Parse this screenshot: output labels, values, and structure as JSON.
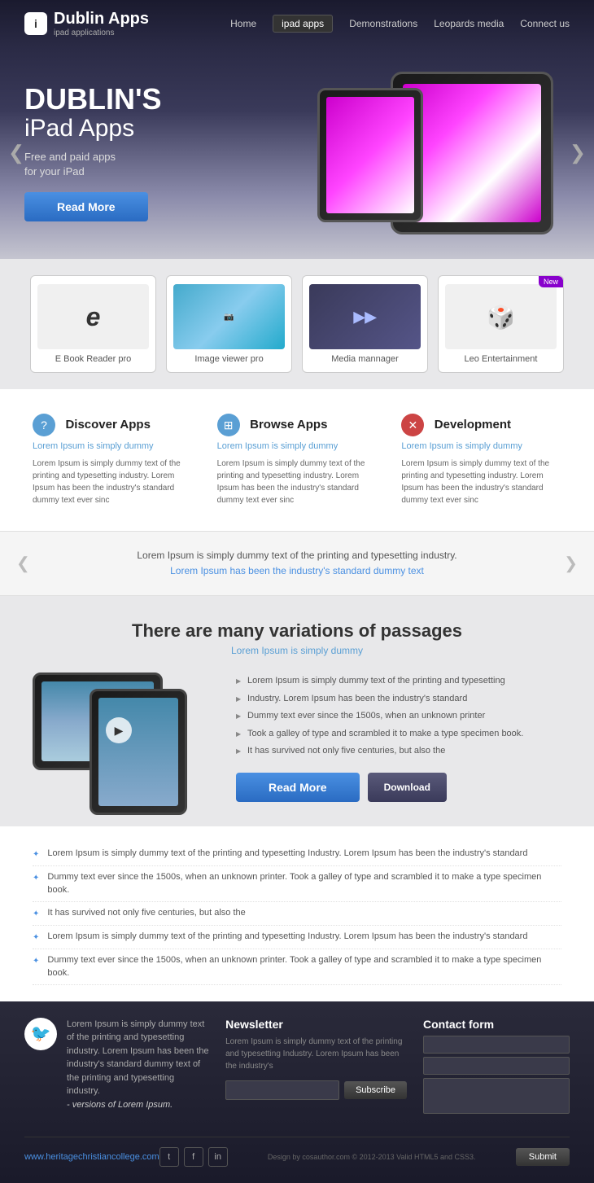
{
  "header": {
    "logo_icon": "i",
    "logo_title": "Dublin Apps",
    "logo_subtitle": "ipad applications",
    "nav": [
      {
        "label": "Home",
        "active": false
      },
      {
        "label": "ipad apps",
        "active": true
      },
      {
        "label": "Demonstrations",
        "active": false
      },
      {
        "label": "Leopards media",
        "active": false
      },
      {
        "label": "Connect us",
        "active": false
      }
    ]
  },
  "hero": {
    "title_main": "DUBLIN'S",
    "title_sub": "iPad Apps",
    "description": "Free and paid apps\nfor your iPad",
    "cta_label": "Read More"
  },
  "apps": [
    {
      "label": "E Book Reader pro",
      "icon_type": "ebook",
      "new": false
    },
    {
      "label": "Image viewer pro",
      "icon_type": "photo",
      "new": false
    },
    {
      "label": "Media mannager",
      "icon_type": "media",
      "new": false
    },
    {
      "label": "Leo Entertainment",
      "icon_type": "dice",
      "new": true
    }
  ],
  "features": [
    {
      "icon": "?",
      "title": "Discover Apps",
      "subtitle": "Lorem Ipsum is simply dummy",
      "text": "Lorem Ipsum is simply dummy text of the printing and typesetting industry. Lorem Ipsum has been the industry's standard dummy text ever sinc"
    },
    {
      "icon": "⊞",
      "title": "Browse Apps",
      "subtitle": "Lorem Ipsum is simply dummy",
      "text": "Lorem Ipsum is simply dummy text of the printing and typesetting industry. Lorem Ipsum has been the industry's standard dummy text ever sinc"
    },
    {
      "icon": "✕",
      "title": "Development",
      "subtitle": "Lorem Ipsum is simply dummy",
      "text": "Lorem Ipsum is simply dummy text of the printing and typesetting industry. Lorem Ipsum has been the industry's standard dummy text ever sinc"
    }
  ],
  "testimonial": {
    "text": "Lorem Ipsum is simply dummy text of the printing and typesetting industry.",
    "highlight_text": "Lorem Ipsum has been the industry's standard dummy text"
  },
  "mid": {
    "title": "There are many variations of passages",
    "subtitle": "Lorem Ipsum is simply dummy",
    "list_items": [
      "Lorem Ipsum is simply dummy text of the printing and typesetting",
      "Industry. Lorem Ipsum has been the industry's standard",
      "Dummy text ever since the 1500s, when an unknown printer",
      "Took a galley of type and scrambled it to make a type specimen book.",
      "It has survived not only five centuries, but also the"
    ],
    "read_more_label": "Read More",
    "download_label": "Download"
  },
  "bullets": [
    "Lorem Ipsum is simply dummy text of the printing and typesetting Industry. Lorem Ipsum has been the industry's standard",
    "Dummy text ever since the 1500s, when an unknown printer. Took a galley of type and scrambled it to make a type specimen book.",
    "It has survived not only five centuries, but also the",
    "Lorem Ipsum is simply dummy text of the printing and typesetting Industry. Lorem Ipsum has been the industry's standard",
    "Dummy text ever since the 1500s, when an unknown printer. Took a galley of type and scrambled it to make a type specimen book."
  ],
  "footer": {
    "twitter_text": "Lorem Ipsum is simply dummy text of the printing and typesetting industry. Lorem Ipsum has been the industry's standard dummy text  of the printing and typesetting industry.",
    "twitter_italic": "- versions of Lorem Ipsum.",
    "newsletter_title": "Newsletter",
    "newsletter_text": "Lorem Ipsum is simply dummy text of the printing and typesetting Industry. Lorem Ipsum has been the industry's",
    "subscribe_label": "Subscribe",
    "contact_title": "Contact form",
    "url": "www.heritagechristiancollege.com",
    "social_icons": [
      "t",
      "f",
      "in"
    ],
    "copyright": "Design by cosauthor.com © 2012-2013  Valid HTML5 and CSS3.",
    "submit_label": "Submit"
  }
}
